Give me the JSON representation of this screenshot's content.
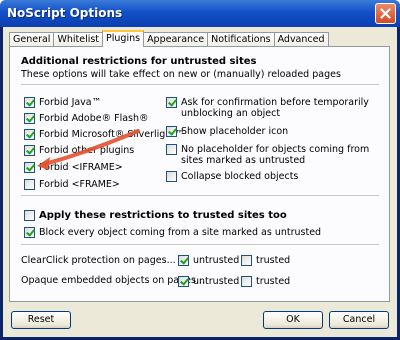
{
  "window": {
    "title": "NoScript Options"
  },
  "tabs": [
    {
      "label": "General"
    },
    {
      "label": "Whitelist"
    },
    {
      "label": "Plugins"
    },
    {
      "label": "Appearance"
    },
    {
      "label": "Notifications"
    },
    {
      "label": "Advanced"
    }
  ],
  "active_tab": "Plugins",
  "plugins": {
    "heading": "Additional restrictions for untrusted sites",
    "subheading": "These options will take effect on new or (manually) reloaded pages",
    "left_options": [
      {
        "label": "Forbid Java™",
        "checked": true
      },
      {
        "label": "Forbid Adobe® Flash®",
        "checked": true
      },
      {
        "label": "Forbid Microsoft® Silverlight™",
        "checked": true
      },
      {
        "label": "Forbid other plugins",
        "checked": true
      },
      {
        "label": "Forbid <IFRAME>",
        "checked": true
      },
      {
        "label": "Forbid <FRAME>",
        "checked": false
      }
    ],
    "right_options": [
      {
        "label": "Ask for confirmation before temporarily unblocking an object",
        "checked": true
      },
      {
        "label": "Show placeholder icon",
        "checked": true
      },
      {
        "label": "No placeholder for objects coming from sites marked as untrusted",
        "checked": false
      },
      {
        "label": "Collapse blocked objects",
        "checked": false
      }
    ],
    "apply_trusted": {
      "label": "Apply these restrictions to trusted sites too",
      "checked": false
    },
    "block_untrusted": {
      "label": "Block every object coming from a site marked as untrusted",
      "checked": true
    },
    "clearclick": {
      "label": "ClearClick protection on pages...",
      "untrusted_label": "untrusted",
      "untrusted_checked": true,
      "trusted_label": "trusted",
      "trusted_checked": false
    },
    "opaque": {
      "label": "Opaque embedded objects on pages...",
      "untrusted_label": "untrusted",
      "untrusted_checked": true,
      "trusted_label": "trusted",
      "trusted_checked": false
    }
  },
  "buttons": {
    "reset": "Reset",
    "ok": "OK",
    "cancel": "Cancel"
  },
  "colors": {
    "title_bar": "#1350c8",
    "dialog_bg": "#ece9d8",
    "annotation_arrow": "#e2512d"
  },
  "icons": [
    "close-icon",
    "annotation-arrow"
  ]
}
